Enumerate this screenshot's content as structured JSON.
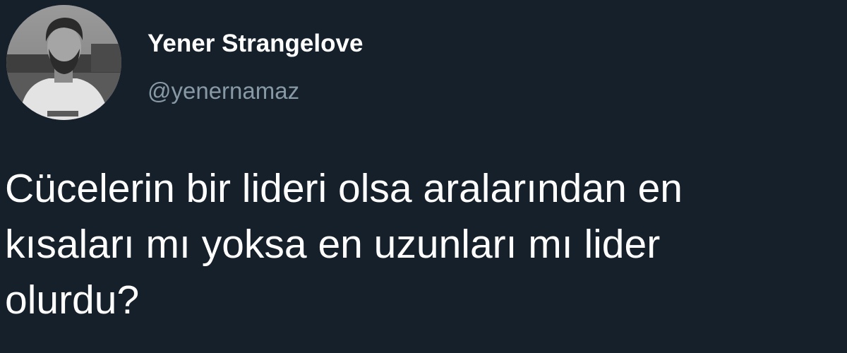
{
  "author": {
    "display_name": "Yener Strangelove",
    "handle": "@yenernamaz"
  },
  "tweet": {
    "lines": [
      "Cücelerin bir lideri olsa aralarından en",
      "kısaları mı yoksa en uzunları mı lider",
      "olurdu?"
    ]
  },
  "colors": {
    "background": "#15202b",
    "name_text": "#ffffff",
    "handle_text": "#8899a6",
    "body_text": "#ffffff"
  }
}
